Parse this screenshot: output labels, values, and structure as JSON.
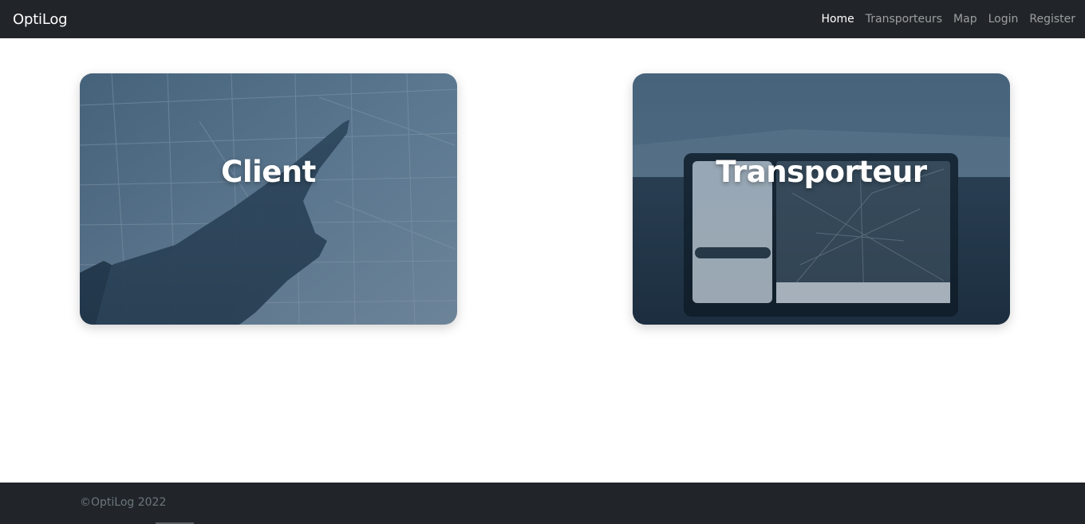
{
  "navbar": {
    "brand": "OptiLog",
    "links": [
      {
        "label": "Home",
        "active": true
      },
      {
        "label": "Transporteurs",
        "active": false
      },
      {
        "label": "Map",
        "active": false
      },
      {
        "label": "Login",
        "active": false
      },
      {
        "label": "Register",
        "active": false
      }
    ]
  },
  "cards": [
    {
      "title": "Client",
      "image": "hand-pointing-at-map-image"
    },
    {
      "title": "Transporteur",
      "image": "car-dashboard-navigation-screen-image"
    }
  ],
  "footer": {
    "copyright": "©OptiLog 2022"
  },
  "colors": {
    "navbar_bg": "#212529",
    "card_tint": "#35546e",
    "footer_text": "#6c757d"
  }
}
